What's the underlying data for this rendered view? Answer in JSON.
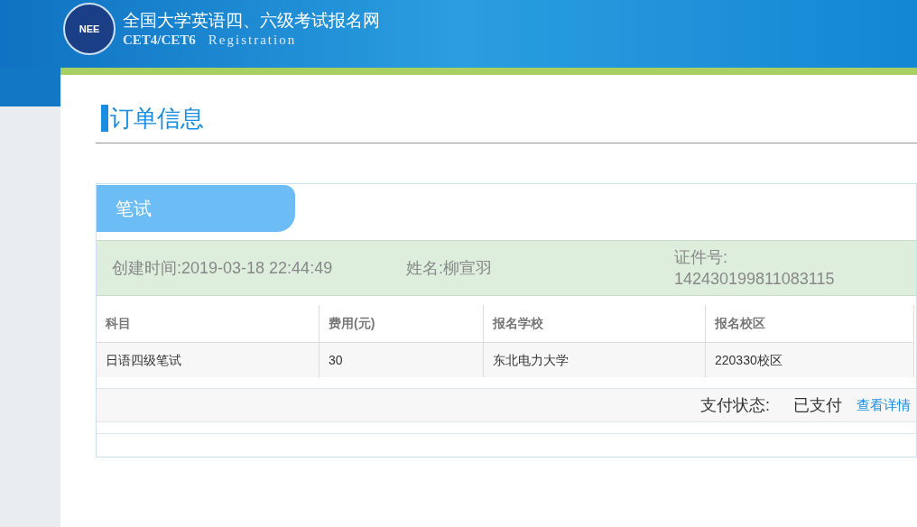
{
  "header": {
    "logo_text": "NEE",
    "title": "全国大学英语四、六级考试报名网",
    "subtitle": "CET4/CET6",
    "subtitle_2": "Registration"
  },
  "page_title": "订单信息",
  "order": {
    "tab": "笔试",
    "info": [
      {
        "label": "创建时间:",
        "value": "2019-03-18 22:44:49"
      },
      {
        "label": "姓名:",
        "value": "柳宣羽"
      },
      {
        "label": "证件号:",
        "value": "142430199811083115"
      }
    ],
    "table": {
      "columns": [
        "科目",
        "费用(元)",
        "报名学校",
        "报名校区"
      ],
      "rows": [
        [
          "日语四级笔试",
          "30",
          "东北电力大学",
          "220330校区"
        ]
      ]
    },
    "payment": {
      "label": "支付状态:",
      "value": "已支付",
      "link": "查看详情"
    }
  }
}
